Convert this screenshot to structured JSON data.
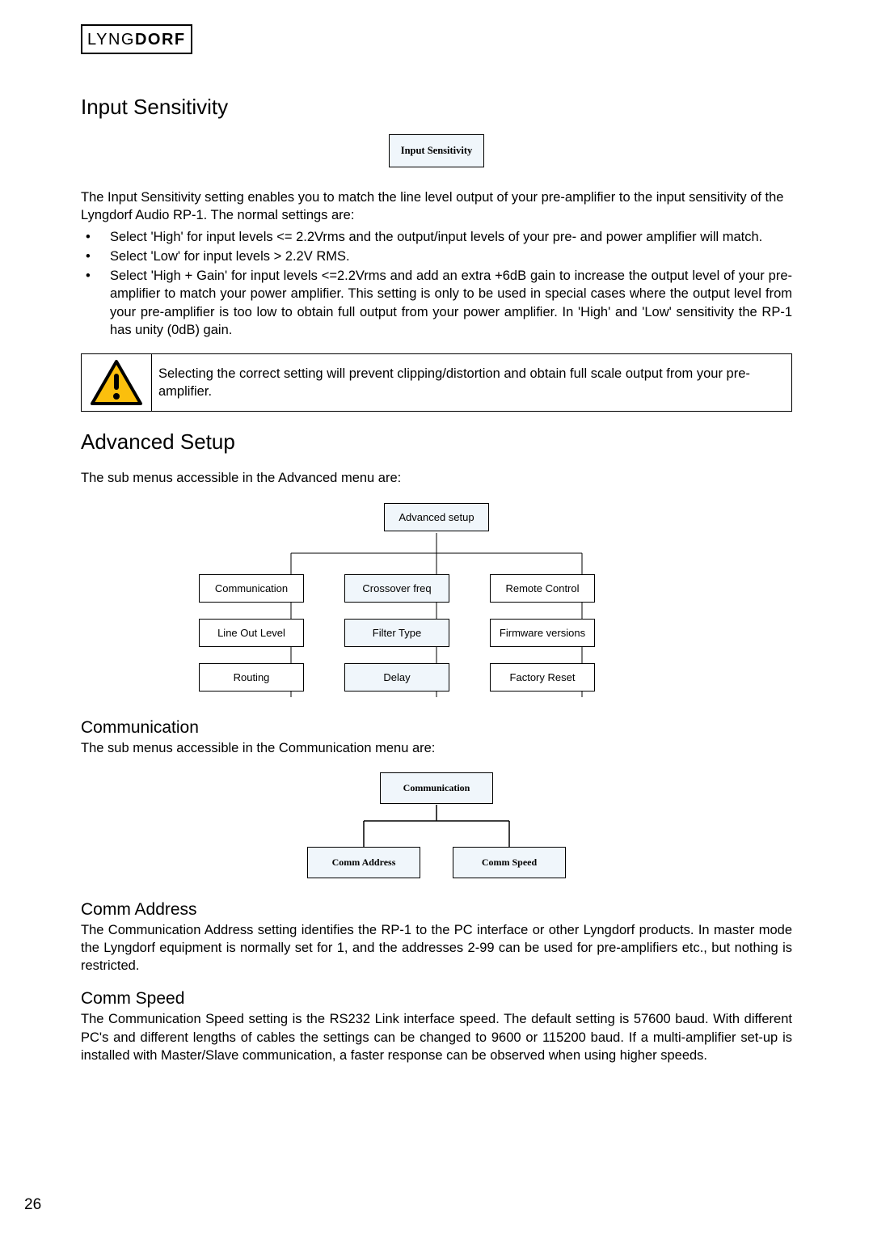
{
  "logo": {
    "part1": "LYNG",
    "part2": "DORF"
  },
  "section1": {
    "title": "Input Sensitivity",
    "box_label": "Input Sensitivity",
    "intro": "The Input Sensitivity setting enables you to match the line level output of your pre-amplifier to the input sensitivity of the Lyngdorf Audio RP-1. The normal settings are:",
    "bullets": [
      "Select 'High' for input levels <= 2.2Vrms and the output/input levels of your pre- and power amplifier will match.",
      "Select 'Low' for input levels > 2.2V RMS.",
      "Select 'High + Gain' for input levels <=2.2Vrms and add an  extra +6dB gain to increase the output level of your pre-amplifier to match your power amplifier. This setting is only to be used in special cases where the output level from  your pre-amplifier is too low to obtain full output from your power amplifier. In 'High' and 'Low' sensitivity the RP-1 has unity (0dB) gain."
    ],
    "warning": "Selecting the correct setting will prevent clipping/distortion and obtain full scale output from your pre-amplifier."
  },
  "section2": {
    "title": "Advanced Setup",
    "intro": "The sub menus accessible in the Advanced menu are:",
    "root": "Advanced setup",
    "col1": [
      "Communication",
      "Line Out Level",
      "Routing"
    ],
    "col2": [
      "Crossover freq",
      "Filter Type",
      "Delay"
    ],
    "col3": [
      "Remote Control",
      "Firmware versions",
      "Factory Reset"
    ]
  },
  "section3": {
    "title": "Communication",
    "intro": "The sub menus accessible in the Communication menu are:",
    "root": "Communication",
    "children": [
      "Comm Address",
      "Comm Speed"
    ]
  },
  "section4": {
    "title": "Comm Address",
    "body": "The Communication Address setting identifies the RP-1 to the PC interface or other Lyngdorf products. In master mode the Lyngdorf equipment is normally set for 1, and the addresses 2-99 can be used for pre-amplifiers etc., but nothing is restricted."
  },
  "section5": {
    "title": "Comm Speed",
    "body": "The Communication Speed setting is the RS232 Link interface speed. The default setting is 57600 baud. With different PC's and different lengths of cables the settings can be changed to 9600 or 115200 baud. If a multi-amplifier set-up is installed with Master/Slave communication, a faster response can be observed when using higher speeds."
  },
  "page_number": "26"
}
